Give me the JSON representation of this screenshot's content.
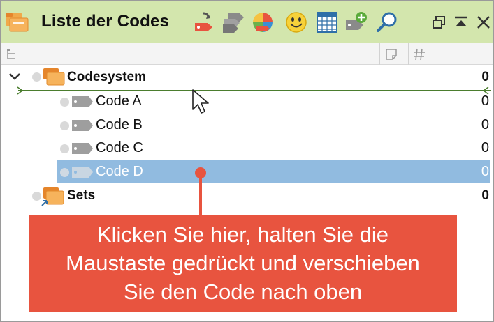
{
  "window": {
    "title": "Liste der Codes"
  },
  "toolbar": {
    "buttons": [
      {
        "icon": "new-code-icon"
      },
      {
        "icon": "code-tags-icon"
      },
      {
        "icon": "color-wheel-icon"
      },
      {
        "icon": "smiley-icon"
      },
      {
        "icon": "table-icon"
      },
      {
        "icon": "add-code-icon"
      },
      {
        "icon": "magnifier-icon"
      }
    ],
    "window_buttons": [
      {
        "icon": "restore-window-icon"
      },
      {
        "icon": "collapse-up-icon"
      },
      {
        "icon": "close-icon"
      }
    ]
  },
  "columns": {
    "tree_icon": "tree-view-icon",
    "memo_icon": "memo-icon",
    "count_icon": "hash-icon"
  },
  "tree": {
    "root": {
      "label": "Codesystem",
      "count": "0",
      "expanded": true
    },
    "codes": [
      {
        "label": "Code A",
        "count": "0",
        "selected": false
      },
      {
        "label": "Code B",
        "count": "0",
        "selected": false
      },
      {
        "label": "Code C",
        "count": "0",
        "selected": false
      },
      {
        "label": "Code D",
        "count": "0",
        "selected": true
      }
    ],
    "sets": {
      "label": "Sets",
      "count": "0"
    }
  },
  "callout": {
    "lines": [
      "Klicken Sie hier, halten Sie die",
      "Maustaste gedrückt und verschieben",
      "Sie den Code nach oben"
    ]
  },
  "colors": {
    "titlebar": "#d3e6ad",
    "selection": "#91bbe0",
    "callout": "#e8543f",
    "dropline": "#4b7d2e"
  }
}
